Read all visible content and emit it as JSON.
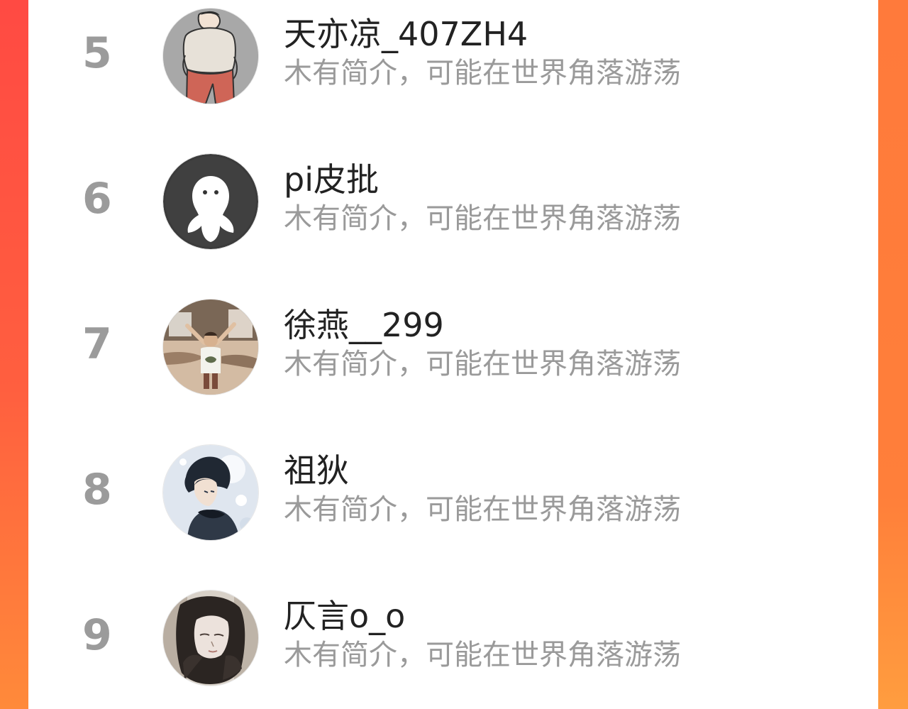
{
  "ranking": {
    "items": [
      {
        "rank": "5",
        "name": "天亦凉_407ZH4",
        "intro": "木有简介，可能在世界角落游荡",
        "avatar_icon": "avatar-cartoon-person-icon"
      },
      {
        "rank": "6",
        "name": "pi皮批",
        "intro": "木有简介，可能在世界角落游荡",
        "avatar_icon": "avatar-default-ghost-icon"
      },
      {
        "rank": "7",
        "name": "徐燕__299",
        "intro": "木有简介，可能在世界角落游荡",
        "avatar_icon": "avatar-child-photo-icon"
      },
      {
        "rank": "8",
        "name": "祖狄",
        "intro": "木有简介，可能在世界角落游荡",
        "avatar_icon": "avatar-anime-boy-icon"
      },
      {
        "rank": "9",
        "name": "仄言o_o",
        "intro": "木有简介，可能在世界角落游荡",
        "avatar_icon": "avatar-anime-longhair-icon"
      }
    ]
  },
  "colors": {
    "background_left": "#ff4a43",
    "background_right": "#ff7f3a",
    "panel": "#ffffff",
    "rank_text": "#9b9b9b",
    "name_text": "#222222",
    "intro_text": "#9a9a9a"
  }
}
